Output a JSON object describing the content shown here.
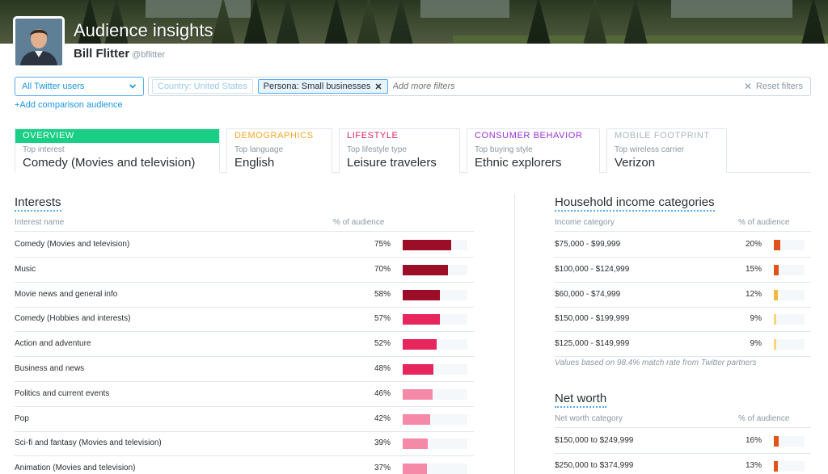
{
  "header": {
    "title": "Audience insights",
    "user_name": "Bill Flitter",
    "user_handle": "@bflitter"
  },
  "filters": {
    "audience_select": "All Twitter users",
    "add_comparison": "+Add comparison audience",
    "chips": [
      "Country: United States",
      "Persona: Small businesses"
    ],
    "chip_remove_glyph": "✕",
    "add_filters_placeholder": "Add more filters",
    "reset_label": "Reset filters",
    "reset_glyph": "✕"
  },
  "tabs": [
    {
      "label": "OVERVIEW",
      "sub": "Top interest",
      "value": "Comedy (Movies and television)",
      "color": "#19cf86",
      "active": true
    },
    {
      "label": "DEMOGRAPHICS",
      "sub": "Top language",
      "value": "English",
      "color": "#f5a623",
      "active": false
    },
    {
      "label": "LIFESTYLE",
      "sub": "Top lifestyle type",
      "value": "Leisure travelers",
      "color": "#e0245e",
      "active": false
    },
    {
      "label": "CONSUMER BEHAVIOR",
      "sub": "Top buying style",
      "value": "Ethnic explorers",
      "color": "#9b30d9",
      "active": false
    },
    {
      "label": "MOBILE FOOTPRINT",
      "sub": "Top wireless carrier",
      "value": "Verizon",
      "color": "#aab8c2",
      "active": false
    }
  ],
  "interests": {
    "title": "Interests",
    "col_name": "Interest name",
    "col_pct": "% of audience",
    "rows": [
      {
        "name": "Comedy (Movies and television)",
        "pct": "75%",
        "value": 75,
        "color": "#9c0d27"
      },
      {
        "name": "Music",
        "pct": "70%",
        "value": 70,
        "color": "#9c0d27"
      },
      {
        "name": "Movie news and general info",
        "pct": "58%",
        "value": 58,
        "color": "#9c0d27"
      },
      {
        "name": "Comedy (Hobbies and interests)",
        "pct": "57%",
        "value": 57,
        "color": "#e8265e"
      },
      {
        "name": "Action and adventure",
        "pct": "52%",
        "value": 52,
        "color": "#e8265e"
      },
      {
        "name": "Business and news",
        "pct": "48%",
        "value": 48,
        "color": "#e8265e"
      },
      {
        "name": "Politics and current events",
        "pct": "46%",
        "value": 46,
        "color": "#f48aa8"
      },
      {
        "name": "Pop",
        "pct": "42%",
        "value": 42,
        "color": "#f48aa8"
      },
      {
        "name": "Sci-fi and fantasy (Movies and television)",
        "pct": "39%",
        "value": 39,
        "color": "#f48aa8"
      },
      {
        "name": "Animation (Movies and television)",
        "pct": "37%",
        "value": 37,
        "color": "#f48aa8"
      }
    ]
  },
  "household_income": {
    "title": "Household income categories",
    "col_name": "Income category",
    "col_pct": "% of audience",
    "rows": [
      {
        "name": "$75,000 - $99,999",
        "pct": "20%",
        "value": 20,
        "color": "#e0531a"
      },
      {
        "name": "$100,000 - $124,999",
        "pct": "15%",
        "value": 15,
        "color": "#e0531a"
      },
      {
        "name": "$60,000 - $74,999",
        "pct": "12%",
        "value": 12,
        "color": "#f5b942"
      },
      {
        "name": "$150,000 - $199,999",
        "pct": "9%",
        "value": 9,
        "color": "#f8d57a"
      },
      {
        "name": "$125,000 - $149,999",
        "pct": "9%",
        "value": 9,
        "color": "#f8d57a"
      }
    ],
    "footnote": "Values based on 98.4% match rate from Twitter partners"
  },
  "net_worth": {
    "title": "Net worth",
    "col_name": "Net worth category",
    "col_pct": "% of audience",
    "rows": [
      {
        "name": "$150,000 to $249,999",
        "pct": "16%",
        "value": 16,
        "color": "#e0531a"
      },
      {
        "name": "$250,000 to $374,999",
        "pct": "13%",
        "value": 13,
        "color": "#e0531a"
      }
    ]
  }
}
